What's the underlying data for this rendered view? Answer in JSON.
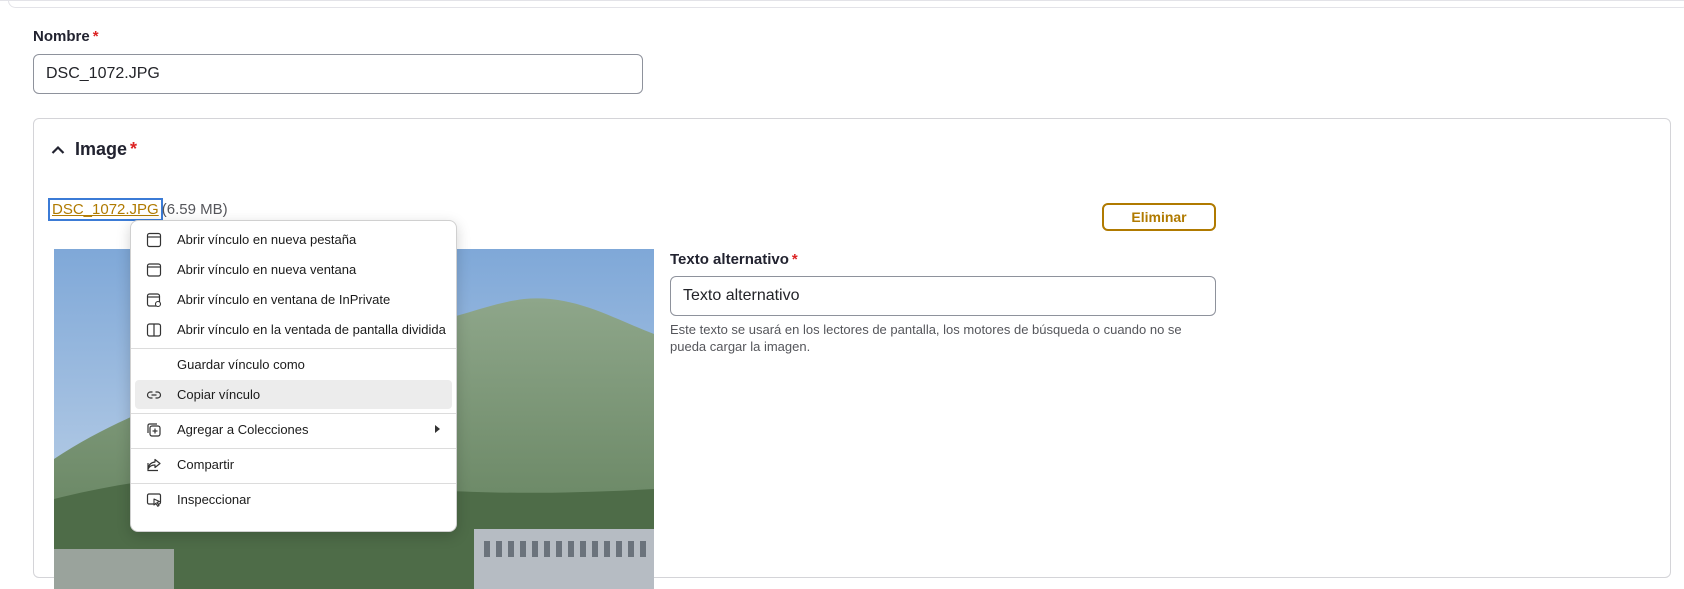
{
  "form": {
    "name_label": "Nombre",
    "required_mark": "*",
    "name_value": "DSC_1072.JPG"
  },
  "image_section": {
    "title": "Image",
    "required_mark": "*",
    "file_name": "DSC_1072.JPG",
    "file_size": "(6.59 MB)",
    "remove_label": "Eliminar",
    "alt_label": "Texto alternativo",
    "alt_required_mark": "*",
    "alt_value": "Texto alternativo",
    "alt_help": "Este texto se usará en los lectores de pantalla, los motores de búsqueda o cuando no se pueda cargar la imagen."
  },
  "context_menu": {
    "items": [
      {
        "label": "Abrir vínculo en nueva pestaña",
        "icon": "new-tab-icon"
      },
      {
        "label": "Abrir vínculo en nueva ventana",
        "icon": "new-window-icon"
      },
      {
        "label": "Abrir vínculo en ventana de InPrivate",
        "icon": "inprivate-window-icon"
      },
      {
        "label": "Abrir vínculo en la ventada de pantalla dividida",
        "icon": "split-screen-icon"
      },
      {
        "label": "Guardar vínculo como",
        "icon": ""
      },
      {
        "label": "Copiar vínculo",
        "icon": "link-icon"
      },
      {
        "label": "Agregar a Colecciones",
        "icon": "collections-icon"
      },
      {
        "label": "Compartir",
        "icon": "share-icon"
      },
      {
        "label": "Inspeccionar",
        "icon": "inspect-icon"
      }
    ],
    "hovered_item": "Copiar vínculo"
  },
  "colors": {
    "accent": "#b07a00",
    "required": "#dc2323",
    "focus": "#3b7bd6"
  }
}
